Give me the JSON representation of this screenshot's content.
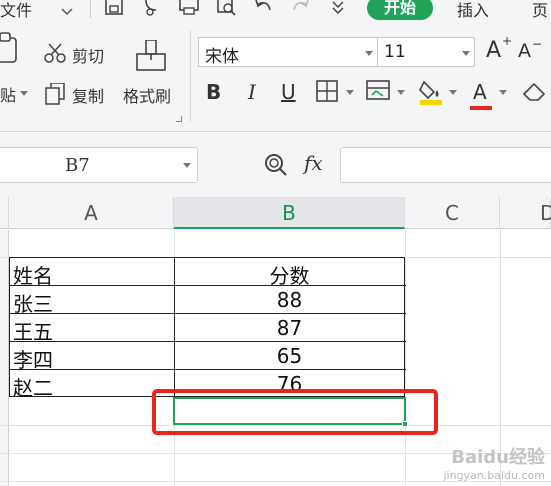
{
  "menu": {
    "file_label": "文件",
    "start_tab": "开始",
    "insert_tab": "插入",
    "page_tab": "页"
  },
  "ribbon": {
    "cut_label": "剪切",
    "copy_label": "复制",
    "paste_label": "贴",
    "format_painter_label": "格式刷",
    "font_name": "宋体",
    "font_size": "11",
    "bold": "B",
    "italic": "I",
    "underline": "U",
    "font_color": "A",
    "grow_font": "A",
    "shrink_font": "A"
  },
  "formula_bar": {
    "name_box": "B7",
    "fx": "fx",
    "formula_value": ""
  },
  "columns": [
    "A",
    "B",
    "C",
    "D"
  ],
  "active_column": "B",
  "table": {
    "header": [
      "姓名",
      "分数"
    ],
    "rows": [
      [
        "张三",
        "88"
      ],
      [
        "王五",
        "87"
      ],
      [
        "李四",
        "65"
      ],
      [
        "赵二",
        "76"
      ]
    ]
  },
  "selected_cell": "B7",
  "watermark": {
    "line1": "Baidu经验",
    "line2": "jingyan.baidu.com"
  },
  "colors": {
    "accent": "#21a35a",
    "highlight": "#e8261f",
    "font_color_bar": "#e8261f",
    "fill_color_bar": "#f2d600"
  }
}
